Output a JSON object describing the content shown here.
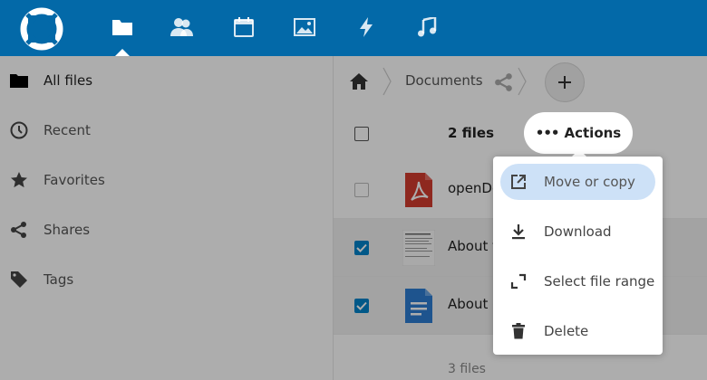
{
  "header": {
    "apps": [
      {
        "icon": "folder-icon",
        "name": "Files",
        "active": true
      },
      {
        "icon": "contacts-icon",
        "name": "Contacts"
      },
      {
        "icon": "calendar-icon",
        "name": "Calendar"
      },
      {
        "icon": "gallery-icon",
        "name": "Gallery"
      },
      {
        "icon": "activity-icon",
        "name": "Activity"
      },
      {
        "icon": "music-icon",
        "name": "Music"
      }
    ],
    "accent_color": "#0369a8"
  },
  "sidebar": {
    "items": [
      {
        "label": "All files",
        "icon": "folder-icon"
      },
      {
        "label": "Recent",
        "icon": "clock-icon"
      },
      {
        "label": "Favorites",
        "icon": "star-icon"
      },
      {
        "label": "Shares",
        "icon": "share-icon"
      },
      {
        "label": "Tags",
        "icon": "tag-icon"
      }
    ]
  },
  "breadcrumb": {
    "current": "Documents"
  },
  "file_list": {
    "count_label": "2 files",
    "rows": [
      {
        "name": "openDo",
        "checked": false,
        "icon": "pdf-icon"
      },
      {
        "name": "About t",
        "checked": true,
        "icon": "text-thumbnail"
      },
      {
        "name": "About d",
        "checked": true,
        "icon": "document-icon"
      }
    ],
    "summary": "3 files"
  },
  "actions": {
    "button_dots": "•••",
    "button_label": "Actions",
    "menu": [
      {
        "label": "Move or copy",
        "icon": "external-link-icon",
        "highlighted": true
      },
      {
        "label": "Download",
        "icon": "download-icon"
      },
      {
        "label": "Select file range",
        "icon": "range-select-icon"
      },
      {
        "label": "Delete",
        "icon": "trash-icon"
      }
    ]
  }
}
